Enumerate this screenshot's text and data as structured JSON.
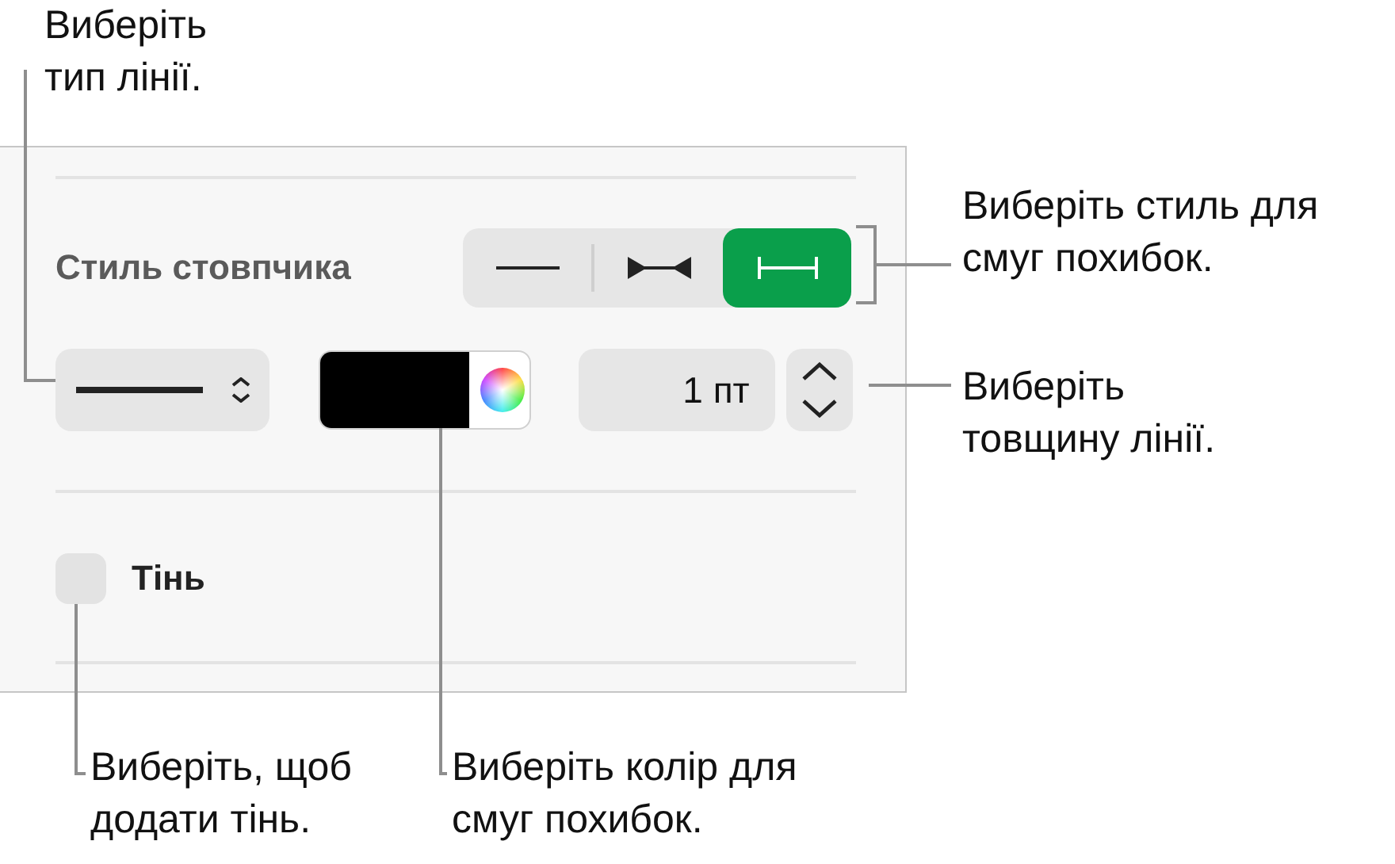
{
  "panel": {
    "bar_style": {
      "label": "Стиль стовпчика",
      "segments": [
        {
          "kind": "plain",
          "selected": false
        },
        {
          "kind": "arrows",
          "selected": false
        },
        {
          "kind": "bars",
          "selected": true
        }
      ]
    },
    "line_style": {
      "kind": "solid"
    },
    "color_well": {
      "color": "#000000"
    },
    "width": {
      "value": "1 пт"
    },
    "shadow": {
      "label": "Тінь",
      "checked": false
    }
  },
  "callouts": [
    {
      "text": "Виберіть\nтип лінії."
    },
    {
      "text": "Виберіть стиль для\nсмуг похибок."
    },
    {
      "text": "Виберіть\nтовщину лінії."
    },
    {
      "text": "Виберіть, щоб\nдодати тінь."
    },
    {
      "text": "Виберіть колір для\nсмуг похибок."
    }
  ]
}
